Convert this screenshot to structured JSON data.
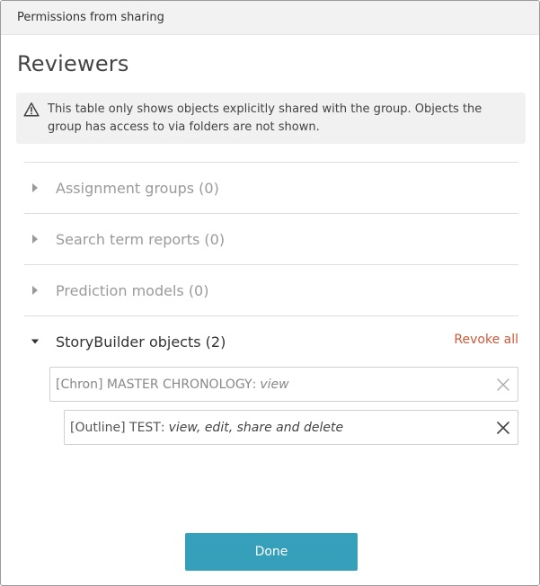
{
  "dialog": {
    "title": "Permissions from sharing",
    "heading": "Reviewers",
    "notice": "This table only shows objects explicitly shared with the group. Objects the group has access to via folders are not shown."
  },
  "sections": [
    {
      "label": "Assignment groups (0)",
      "expanded": false
    },
    {
      "label": "Search term reports (0)",
      "expanded": false
    },
    {
      "label": "Prediction models (0)",
      "expanded": false
    },
    {
      "label": "StoryBuilder objects (2)",
      "expanded": true,
      "action": "Revoke all"
    }
  ],
  "permissions": [
    {
      "object": "[Chron] MASTER CHRONOLOGY",
      "separator": ":",
      "rights": "view"
    },
    {
      "object": "[Outline] TEST",
      "separator": ":",
      "rights": "view, edit, share and delete"
    }
  ],
  "buttons": {
    "done": "Done"
  },
  "icons": {
    "notice": "warning-triangle-icon",
    "collapsed": "caret-right-icon",
    "expanded": "caret-down-icon",
    "remove": "close-icon"
  },
  "colors": {
    "primary": "#369fb9",
    "danger_link": "#cc5a3c",
    "muted_text": "#9a9a9a"
  }
}
